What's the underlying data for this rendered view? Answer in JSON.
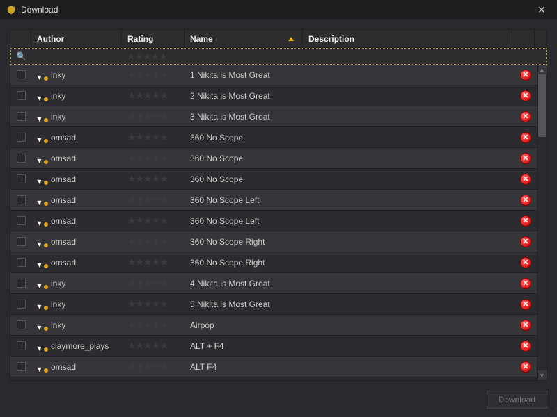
{
  "window": {
    "title": "Download",
    "close_glyph": "✕"
  },
  "columns": {
    "author": "Author",
    "rating": "Rating",
    "name": "Name",
    "description": "Description"
  },
  "sort": {
    "column": "name",
    "dir": "asc"
  },
  "rows": [
    {
      "author": "inky",
      "name": "1 Nikita is Most Great",
      "icon": "cursor-dot"
    },
    {
      "author": "inky",
      "name": "2 Nikita is Most Great",
      "icon": "cursor-dot"
    },
    {
      "author": "inky",
      "name": "3 Nikita is Most Great",
      "icon": "cursor-dot"
    },
    {
      "author": "omsad",
      "name": "360 No Scope",
      "icon": "cursor-dot-alt"
    },
    {
      "author": "omsad",
      "name": "360 No Scope",
      "icon": "cursor-dot-alt"
    },
    {
      "author": "omsad",
      "name": "360 No Scope",
      "icon": "cursor-dot-alt"
    },
    {
      "author": "omsad",
      "name": "360 No Scope Left",
      "icon": "cursor-dot"
    },
    {
      "author": "omsad",
      "name": "360 No Scope Left",
      "icon": "cursor-dot"
    },
    {
      "author": "omsad",
      "name": "360 No Scope Right",
      "icon": "cursor-dot"
    },
    {
      "author": "omsad",
      "name": "360 No Scope Right",
      "icon": "cursor-dot"
    },
    {
      "author": "inky",
      "name": "4 Nikita is Most Great",
      "icon": "cursor-dot"
    },
    {
      "author": "inky",
      "name": "5 Nikita is Most Great",
      "icon": "cursor-dot"
    },
    {
      "author": "inky",
      "name": "Airpop",
      "icon": "cursor-dot"
    },
    {
      "author": "claymore_plays",
      "name": "ALT + F4",
      "icon": "cursor-dot"
    },
    {
      "author": "omsad",
      "name": "ALT F4",
      "icon": "cursor-dot"
    }
  ],
  "footer": {
    "download_label": "Download"
  },
  "glyphs": {
    "star": "★",
    "magnify": "🔍",
    "x": "✕",
    "up": "▲",
    "down": "▼"
  }
}
